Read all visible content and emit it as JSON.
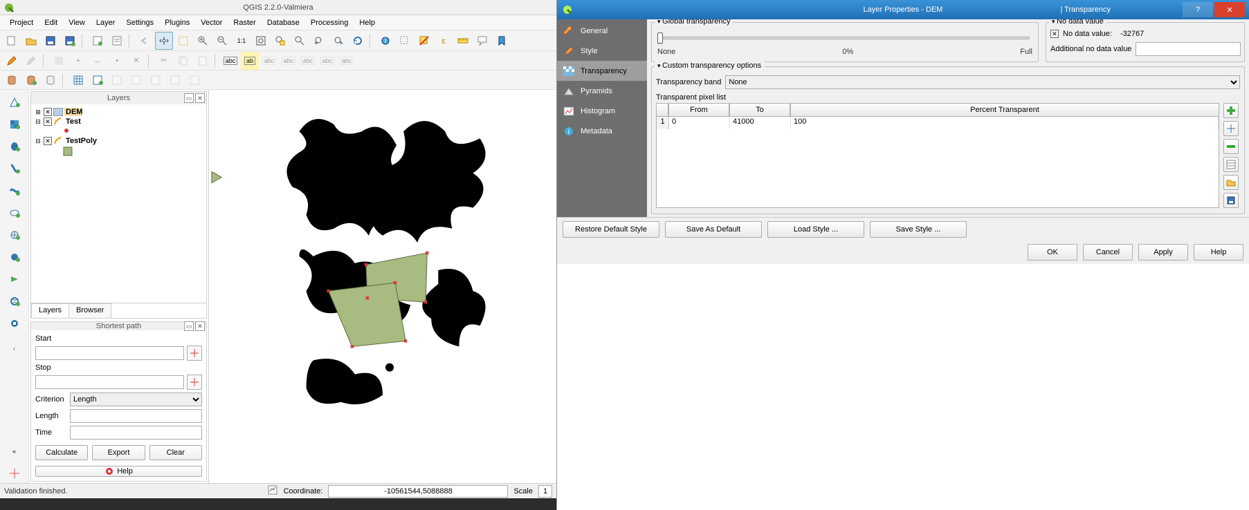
{
  "qgis": {
    "title": "QGIS 2.2.0-Valmiera",
    "menu": [
      "Project",
      "Edit",
      "View",
      "Layer",
      "Settings",
      "Plugins",
      "Vector",
      "Raster",
      "Database",
      "Processing",
      "Help"
    ],
    "layers_panel": {
      "title": "Layers",
      "tab_layers": "Layers",
      "tab_browser": "Browser",
      "items": [
        {
          "name": "DEM"
        },
        {
          "name": "Test"
        },
        {
          "name": "TestPoly"
        }
      ]
    },
    "shortest_path": {
      "title": "Shortest path",
      "start_label": "Start",
      "stop_label": "Stop",
      "criterion_label": "Criterion",
      "criterion_value": "Length",
      "length_label": "Length",
      "time_label": "Time",
      "calc": "Calculate",
      "export": "Export",
      "clear": "Clear",
      "help": "Help"
    },
    "status": {
      "validation": "Validation finished.",
      "coordinate_label": "Coordinate:",
      "coordinate_value": "-10561544,5088888",
      "scale_label": "Scale",
      "scale_value": "1"
    }
  },
  "dialog": {
    "title": "Layer Properties - DEM",
    "section": "| Transparency",
    "sidebar": {
      "general": "General",
      "style": "Style",
      "transparency": "Transparency",
      "pyramids": "Pyramids",
      "histogram": "Histogram",
      "metadata": "Metadata"
    },
    "global": {
      "legend": "Global transparency",
      "none": "None",
      "pct": "0%",
      "full": "Full"
    },
    "nodata": {
      "legend": "No data value",
      "checkbox_label": "No data value:",
      "value": "-32767",
      "additional_label": "Additional no data value"
    },
    "custom": {
      "legend": "Custom transparency options",
      "band_label": "Transparency band",
      "band_value": "None",
      "list_label": "Transparent pixel list",
      "cols": {
        "from": "From",
        "to": "To",
        "pct": "Percent Transparent"
      },
      "row": {
        "from": "0",
        "to": "41000",
        "pct": "100"
      }
    },
    "buttons": {
      "restore": "Restore Default Style",
      "savedef": "Save As Default",
      "load": "Load Style ...",
      "savestyle": "Save Style ...",
      "ok": "OK",
      "cancel": "Cancel",
      "apply": "Apply",
      "help": "Help"
    }
  }
}
